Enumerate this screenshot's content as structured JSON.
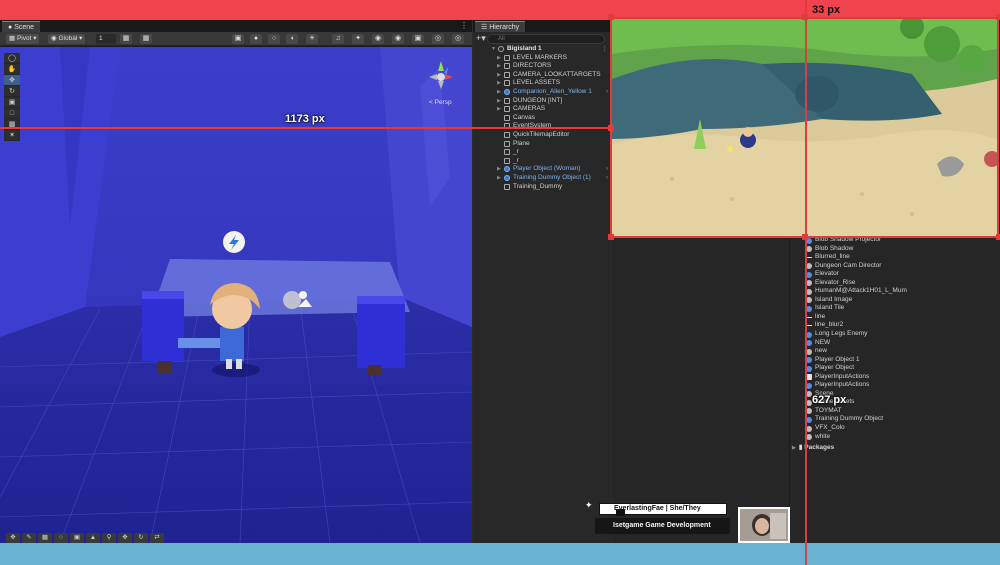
{
  "scene_window": {
    "tab_label": "Scene",
    "pivot_label": "Pivot",
    "global_label": "Global",
    "snap_value": "1",
    "persp_label": "< Persp",
    "tools": [
      "view-tool",
      "hand-tool",
      "move-tool",
      "rotate-tool",
      "scale-tool",
      "rect-tool",
      "transform-tool",
      "custom-tool"
    ]
  },
  "hierarchy": {
    "tab_label": "Hierarchy",
    "search_placeholder": "All",
    "scene_name": "Bigisland 1",
    "items": [
      {
        "label": "LEVEL MARKERS",
        "type": "object",
        "expandable": true
      },
      {
        "label": "DIRECTORS",
        "type": "object",
        "expandable": true
      },
      {
        "label": "CAMERA_LOOKATTARGETS",
        "type": "object",
        "expandable": true
      },
      {
        "label": "LEVEL ASSETS",
        "type": "object",
        "expandable": true
      },
      {
        "label": "Companion_Alien_Yellow 1",
        "type": "prefab",
        "expandable": true
      },
      {
        "label": "DUNGEON [INT]",
        "type": "object",
        "expandable": true
      },
      {
        "label": "CAMERAS",
        "type": "object",
        "expandable": true
      },
      {
        "label": "Canvas",
        "type": "object",
        "expandable": false
      },
      {
        "label": "EventSystem",
        "type": "object",
        "expandable": false
      },
      {
        "label": "QuickTilemapEditor",
        "type": "object",
        "expandable": false
      },
      {
        "label": "Plane",
        "type": "object",
        "expandable": false
      },
      {
        "label": "_r",
        "type": "object",
        "expandable": false
      },
      {
        "label": "_r",
        "type": "object",
        "expandable": false
      },
      {
        "label": "Player Object (Woman)",
        "type": "prefab",
        "expandable": true
      },
      {
        "label": "Training Dummy Object (1)",
        "type": "prefab",
        "expandable": true
      },
      {
        "label": "Training_Dummy",
        "type": "object",
        "expandable": false
      }
    ]
  },
  "project": {
    "items": [
      {
        "label": "Blob Shadow Projector",
        "icon": "blue"
      },
      {
        "label": "Blob Shadow",
        "icon": "grey"
      },
      {
        "label": "Blurred_line",
        "icon": "line"
      },
      {
        "label": "Dungeon Cam Director",
        "icon": "grey"
      },
      {
        "label": "Elevator",
        "icon": "blue"
      },
      {
        "label": "Elevator_Rise",
        "icon": "grey"
      },
      {
        "label": "HumanM@Attack1H01_L_Mum",
        "icon": "grey"
      },
      {
        "label": "Island Image",
        "icon": "grey"
      },
      {
        "label": "Island Tile",
        "icon": "blue"
      },
      {
        "label": "line",
        "icon": "line"
      },
      {
        "label": "line_blur2",
        "icon": "line"
      },
      {
        "label": "Long Legs Enemy",
        "icon": "blue"
      },
      {
        "label": "NEW",
        "icon": "blue"
      },
      {
        "label": "new",
        "icon": "grey"
      },
      {
        "label": "Player Object 1",
        "icon": "blue"
      },
      {
        "label": "Player Object",
        "icon": "blue"
      },
      {
        "label": "PlayerInputActions",
        "icon": "file"
      },
      {
        "label": "PlayerInputActions",
        "icon": "blue"
      },
      {
        "label": "Scene",
        "icon": "grey"
      },
      {
        "label": "Scene Assets",
        "icon": "grey"
      },
      {
        "label": "TOYMAT",
        "icon": "grey"
      },
      {
        "label": "Training Dummy Object",
        "icon": "blue"
      },
      {
        "label": "VFX_Colo",
        "icon": "grey"
      },
      {
        "label": "white",
        "icon": "grey"
      }
    ],
    "packages_label": "Packages"
  },
  "measurements": {
    "width_label": "1173 px",
    "top_gap_label": "33 px",
    "height_label": "627 px"
  },
  "stream_overlay": {
    "streamer": "EverlastingFae | She/They",
    "subtitle": "Isetgame Game Development"
  },
  "colors": {
    "top_strip": "#f0434d",
    "bottom_strip": "#6ab2d1",
    "measure": "#e33a3a",
    "prefab": "#7fb2f0"
  }
}
